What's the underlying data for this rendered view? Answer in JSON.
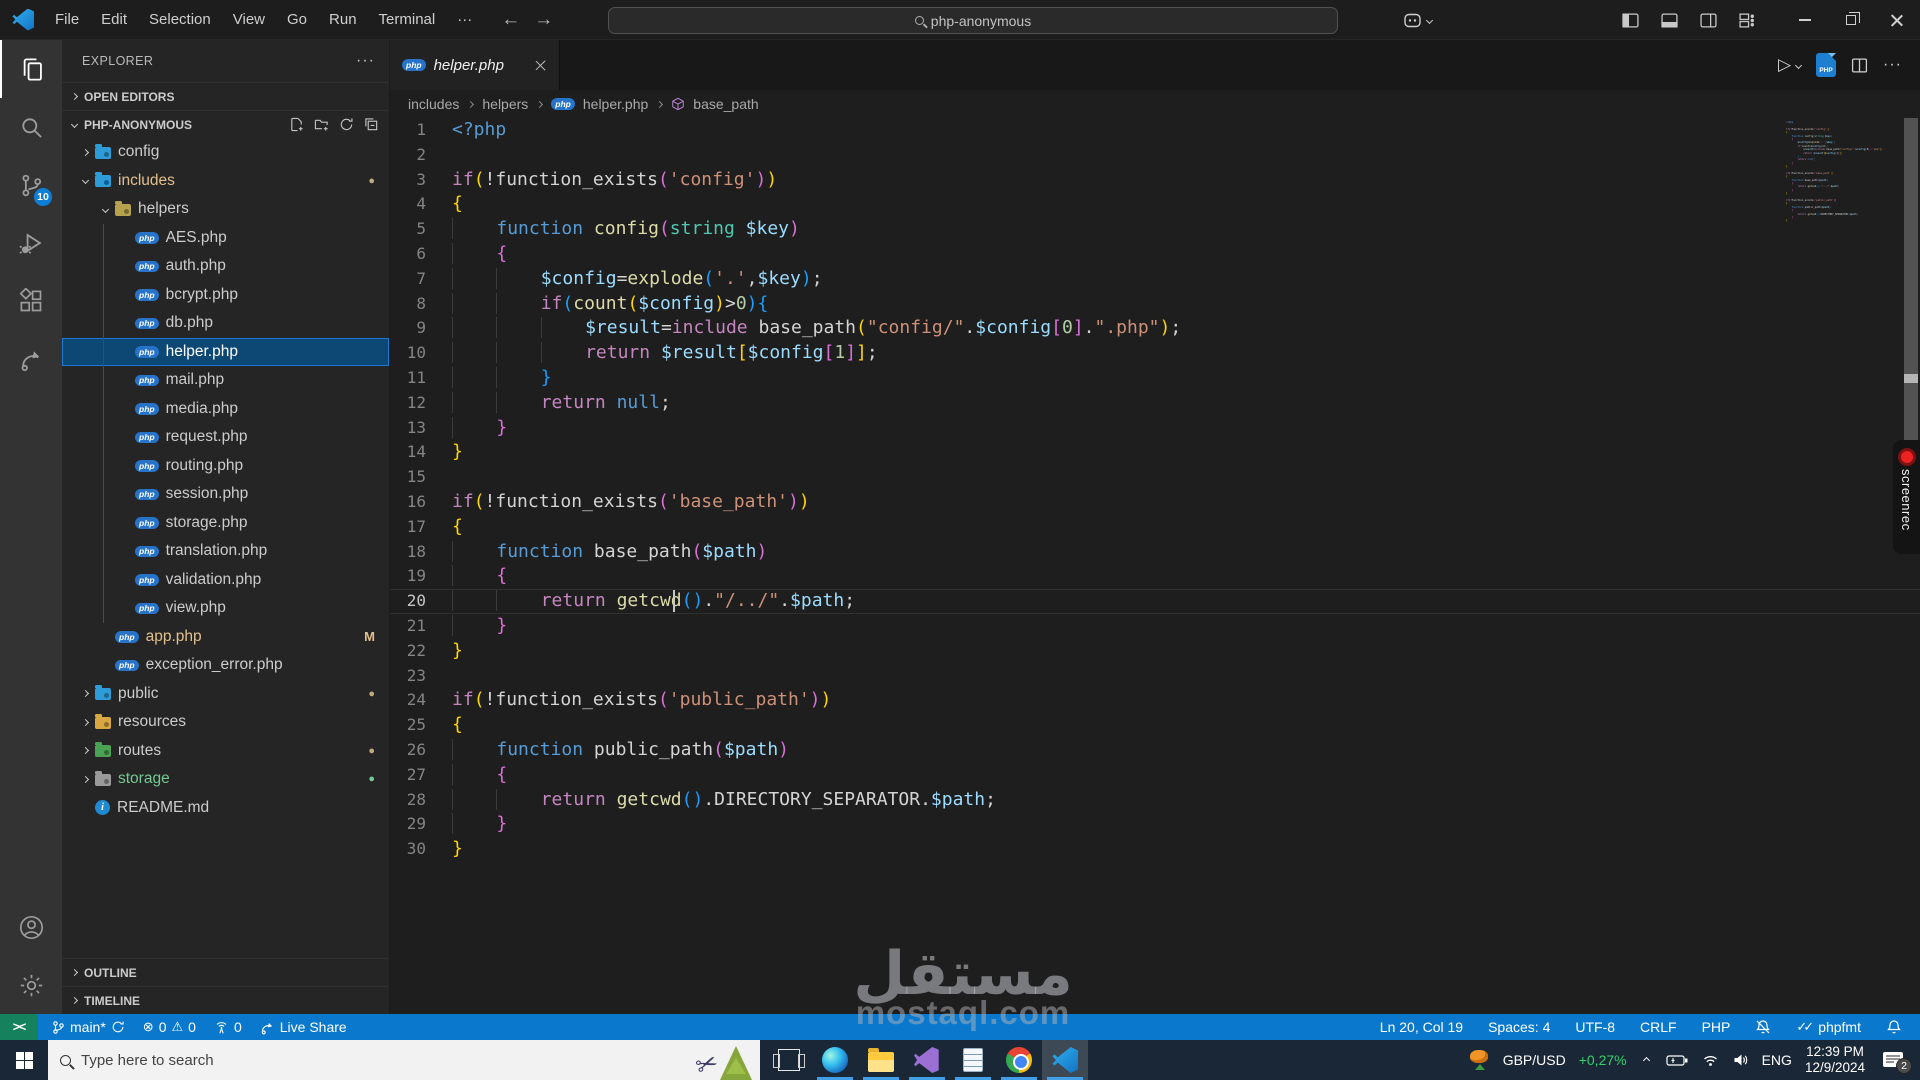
{
  "title_bar": {
    "menus": [
      "File",
      "Edit",
      "Selection",
      "View",
      "Go",
      "Run",
      "Terminal"
    ],
    "more_label": "···",
    "search_value": "php-anonymous"
  },
  "glyphs": {
    "php_badge": "php",
    "remote_indicator": "><",
    "double_check": "✓✓",
    "more": "···",
    "info": "i",
    "scissors": "✂",
    "error": "⊗",
    "warning": "⚠",
    "run": "▷"
  },
  "activity_bar": {
    "source_control_badge": "10"
  },
  "sidebar": {
    "title": "EXPLORER",
    "more_label": "···",
    "open_editors_label": "OPEN EDITORS",
    "project_label": "PHP-ANONYMOUS",
    "outline_label": "OUTLINE",
    "timeline_label": "TIMELINE",
    "tree": [
      {
        "label": "config",
        "depth": 0,
        "type": "folder",
        "folder": "config",
        "chevron": "collapsed"
      },
      {
        "label": "includes",
        "depth": 0,
        "type": "folder",
        "folder": "includes",
        "chevron": "expanded",
        "label_color": "modified",
        "badge": "dot"
      },
      {
        "label": "helpers",
        "depth": 1,
        "type": "folder",
        "folder": "helpers",
        "chevron": "expanded"
      },
      {
        "label": "AES.php",
        "depth": 2,
        "type": "php"
      },
      {
        "label": "auth.php",
        "depth": 2,
        "type": "php"
      },
      {
        "label": "bcrypt.php",
        "depth": 2,
        "type": "php"
      },
      {
        "label": "db.php",
        "depth": 2,
        "type": "php"
      },
      {
        "label": "helper.php",
        "depth": 2,
        "type": "php",
        "selected": true
      },
      {
        "label": "mail.php",
        "depth": 2,
        "type": "php"
      },
      {
        "label": "media.php",
        "depth": 2,
        "type": "php"
      },
      {
        "label": "request.php",
        "depth": 2,
        "type": "php"
      },
      {
        "label": "routing.php",
        "depth": 2,
        "type": "php"
      },
      {
        "label": "session.php",
        "depth": 2,
        "type": "php"
      },
      {
        "label": "storage.php",
        "depth": 2,
        "type": "php"
      },
      {
        "label": "translation.php",
        "depth": 2,
        "type": "php"
      },
      {
        "label": "validation.php",
        "depth": 2,
        "type": "php"
      },
      {
        "label": "view.php",
        "depth": 2,
        "type": "php"
      },
      {
        "label": "app.php",
        "depth": 1,
        "type": "php",
        "label_color": "modified",
        "badge": "M"
      },
      {
        "label": "exception_error.php",
        "depth": 1,
        "type": "php"
      },
      {
        "label": "public",
        "depth": 0,
        "type": "folder",
        "folder": "public",
        "chevron": "collapsed",
        "badge": "dot"
      },
      {
        "label": "resources",
        "depth": 0,
        "type": "folder",
        "folder": "resources",
        "chevron": "collapsed"
      },
      {
        "label": "routes",
        "depth": 0,
        "type": "folder",
        "folder": "routes",
        "chevron": "collapsed",
        "badge": "dot"
      },
      {
        "label": "storage",
        "depth": 0,
        "type": "folder",
        "folder": "storage",
        "chevron": "collapsed",
        "label_color": "new",
        "badge": "dot-green"
      },
      {
        "label": "README.md",
        "depth": 0,
        "type": "info"
      }
    ]
  },
  "editor": {
    "tab": {
      "label": "helper.php"
    },
    "breadcrumbs": [
      "includes",
      "helpers",
      "helper.php",
      "base_path"
    ],
    "current_line": 20,
    "cursor_col": 19,
    "token_colors": {
      "kw": "#C586C0",
      "kw2": "#569CD6",
      "fn": "#DCDCAA",
      "type": "#4EC9B0",
      "var": "#9CDCFE",
      "str": "#CE9178",
      "num": "#B5CEA8",
      "pun": "#D4D4D4",
      "txt": "#D4D4D4",
      "b1": "#FFD700",
      "b2": "#DA70D6",
      "b3": "#179FFF"
    },
    "code_lines": [
      [
        [
          "kw2",
          "<?php"
        ]
      ],
      [],
      [
        [
          "kw",
          "if"
        ],
        [
          "b1",
          "("
        ],
        [
          "pun",
          "!"
        ],
        [
          "txt",
          "function_exists"
        ],
        [
          "b2",
          "("
        ],
        [
          "str",
          "'config'"
        ],
        [
          "b2",
          ")"
        ],
        [
          "b1",
          ")"
        ]
      ],
      [
        [
          "b1",
          "{"
        ]
      ],
      [
        [
          "txt",
          "    "
        ],
        [
          "kw2",
          "function"
        ],
        [
          "txt",
          " "
        ],
        [
          "fn",
          "config"
        ],
        [
          "b2",
          "("
        ],
        [
          "type",
          "string"
        ],
        [
          "txt",
          " "
        ],
        [
          "var",
          "$key"
        ],
        [
          "b2",
          ")"
        ]
      ],
      [
        [
          "txt",
          "    "
        ],
        [
          "b2",
          "{"
        ]
      ],
      [
        [
          "txt",
          "        "
        ],
        [
          "var",
          "$config"
        ],
        [
          "pun",
          "="
        ],
        [
          "fn",
          "explode"
        ],
        [
          "b3",
          "("
        ],
        [
          "str",
          "'.'"
        ],
        [
          "pun",
          ","
        ],
        [
          "var",
          "$key"
        ],
        [
          "b3",
          ")"
        ],
        [
          "pun",
          ";"
        ]
      ],
      [
        [
          "txt",
          "        "
        ],
        [
          "kw",
          "if"
        ],
        [
          "b3",
          "("
        ],
        [
          "fn",
          "count"
        ],
        [
          "b1",
          "("
        ],
        [
          "var",
          "$config"
        ],
        [
          "b1",
          ")"
        ],
        [
          "pun",
          ">"
        ],
        [
          "num",
          "0"
        ],
        [
          "b3",
          ")"
        ],
        [
          "b3",
          "{"
        ]
      ],
      [
        [
          "txt",
          "            "
        ],
        [
          "var",
          "$result"
        ],
        [
          "pun",
          "="
        ],
        [
          "kw",
          "include"
        ],
        [
          "txt",
          " "
        ],
        [
          "txt",
          "base_path"
        ],
        [
          "b1",
          "("
        ],
        [
          "str",
          "\"config/\""
        ],
        [
          "pun",
          "."
        ],
        [
          "var",
          "$config"
        ],
        [
          "b2",
          "["
        ],
        [
          "num",
          "0"
        ],
        [
          "b2",
          "]"
        ],
        [
          "pun",
          "."
        ],
        [
          "str",
          "\".php\""
        ],
        [
          "b1",
          ")"
        ],
        [
          "pun",
          ";"
        ]
      ],
      [
        [
          "txt",
          "            "
        ],
        [
          "kw",
          "return"
        ],
        [
          "txt",
          " "
        ],
        [
          "var",
          "$result"
        ],
        [
          "b1",
          "["
        ],
        [
          "var",
          "$config"
        ],
        [
          "b2",
          "["
        ],
        [
          "num",
          "1"
        ],
        [
          "b2",
          "]"
        ],
        [
          "b1",
          "]"
        ],
        [
          "pun",
          ";"
        ]
      ],
      [
        [
          "txt",
          "        "
        ],
        [
          "b3",
          "}"
        ]
      ],
      [
        [
          "txt",
          "        "
        ],
        [
          "kw",
          "return"
        ],
        [
          "txt",
          " "
        ],
        [
          "kw2",
          "null"
        ],
        [
          "pun",
          ";"
        ]
      ],
      [
        [
          "txt",
          "    "
        ],
        [
          "b2",
          "}"
        ]
      ],
      [
        [
          "b1",
          "}"
        ]
      ],
      [],
      [
        [
          "kw",
          "if"
        ],
        [
          "b1",
          "("
        ],
        [
          "pun",
          "!"
        ],
        [
          "txt",
          "function_exists"
        ],
        [
          "b2",
          "("
        ],
        [
          "str",
          "'base_path'"
        ],
        [
          "b2",
          ")"
        ],
        [
          "b1",
          ")"
        ]
      ],
      [
        [
          "b1",
          "{"
        ]
      ],
      [
        [
          "txt",
          "    "
        ],
        [
          "kw2",
          "function"
        ],
        [
          "txt",
          " "
        ],
        [
          "txt",
          "base_path"
        ],
        [
          "b2",
          "("
        ],
        [
          "var",
          "$path"
        ],
        [
          "b2",
          ")"
        ]
      ],
      [
        [
          "txt",
          "    "
        ],
        [
          "b2",
          "{"
        ]
      ],
      [
        [
          "txt",
          "        "
        ],
        [
          "kw",
          "return"
        ],
        [
          "txt",
          " "
        ],
        [
          "fn",
          "getcwd"
        ],
        [
          "b3",
          "("
        ],
        [
          "b3",
          ")"
        ],
        [
          "pun",
          "."
        ],
        [
          "str",
          "\"/../\""
        ],
        [
          "pun",
          "."
        ],
        [
          "var",
          "$path"
        ],
        [
          "pun",
          ";"
        ]
      ],
      [
        [
          "txt",
          "    "
        ],
        [
          "b2",
          "}"
        ]
      ],
      [
        [
          "b1",
          "}"
        ]
      ],
      [],
      [
        [
          "kw",
          "if"
        ],
        [
          "b1",
          "("
        ],
        [
          "pun",
          "!"
        ],
        [
          "txt",
          "function_exists"
        ],
        [
          "b2",
          "("
        ],
        [
          "str",
          "'public_path'"
        ],
        [
          "b2",
          ")"
        ],
        [
          "b1",
          ")"
        ]
      ],
      [
        [
          "b1",
          "{"
        ]
      ],
      [
        [
          "txt",
          "    "
        ],
        [
          "kw2",
          "function"
        ],
        [
          "txt",
          " "
        ],
        [
          "txt",
          "public_path"
        ],
        [
          "b2",
          "("
        ],
        [
          "var",
          "$path"
        ],
        [
          "b2",
          ")"
        ]
      ],
      [
        [
          "txt",
          "    "
        ],
        [
          "b2",
          "{"
        ]
      ],
      [
        [
          "txt",
          "        "
        ],
        [
          "kw",
          "return"
        ],
        [
          "txt",
          " "
        ],
        [
          "fn",
          "getcwd"
        ],
        [
          "b3",
          "("
        ],
        [
          "b3",
          ")"
        ],
        [
          "pun",
          "."
        ],
        [
          "pun",
          "DIRECTORY_SEPARATOR"
        ],
        [
          "pun",
          "."
        ],
        [
          "var",
          "$path"
        ],
        [
          "pun",
          ";"
        ]
      ],
      [
        [
          "txt",
          "    "
        ],
        [
          "b2",
          "}"
        ]
      ],
      [
        [
          "b1",
          "}"
        ]
      ]
    ]
  },
  "status_bar": {
    "branch": "main*",
    "errors": "0",
    "warnings": "0",
    "ports": "0",
    "live_share": "Live Share",
    "line_col": "Ln 20, Col 19",
    "spaces": "Spaces: 4",
    "encoding": "UTF-8",
    "eol": "CRLF",
    "language": "PHP",
    "formatter": "phpfmt"
  },
  "taskbar": {
    "search_placeholder": "Type here to search",
    "apps": [
      {
        "name": "task-view",
        "running": false
      },
      {
        "name": "edge",
        "running": true
      },
      {
        "name": "file-explorer",
        "running": true
      },
      {
        "name": "visual-studio",
        "running": true
      },
      {
        "name": "notepad",
        "running": true
      },
      {
        "name": "chrome",
        "running": true
      },
      {
        "name": "vscode",
        "running": true,
        "active": true
      }
    ],
    "tray": {
      "ticker_symbol": "GBP/USD",
      "ticker_change": "+0,27%",
      "language": "ENG",
      "time": "12:39 PM",
      "date": "12/9/2024",
      "notification_count": "2"
    }
  },
  "watermark": {
    "arabic": "مستقل",
    "latin": "mostaql.com"
  },
  "overlay": {
    "recorder_label": "screenrec"
  }
}
